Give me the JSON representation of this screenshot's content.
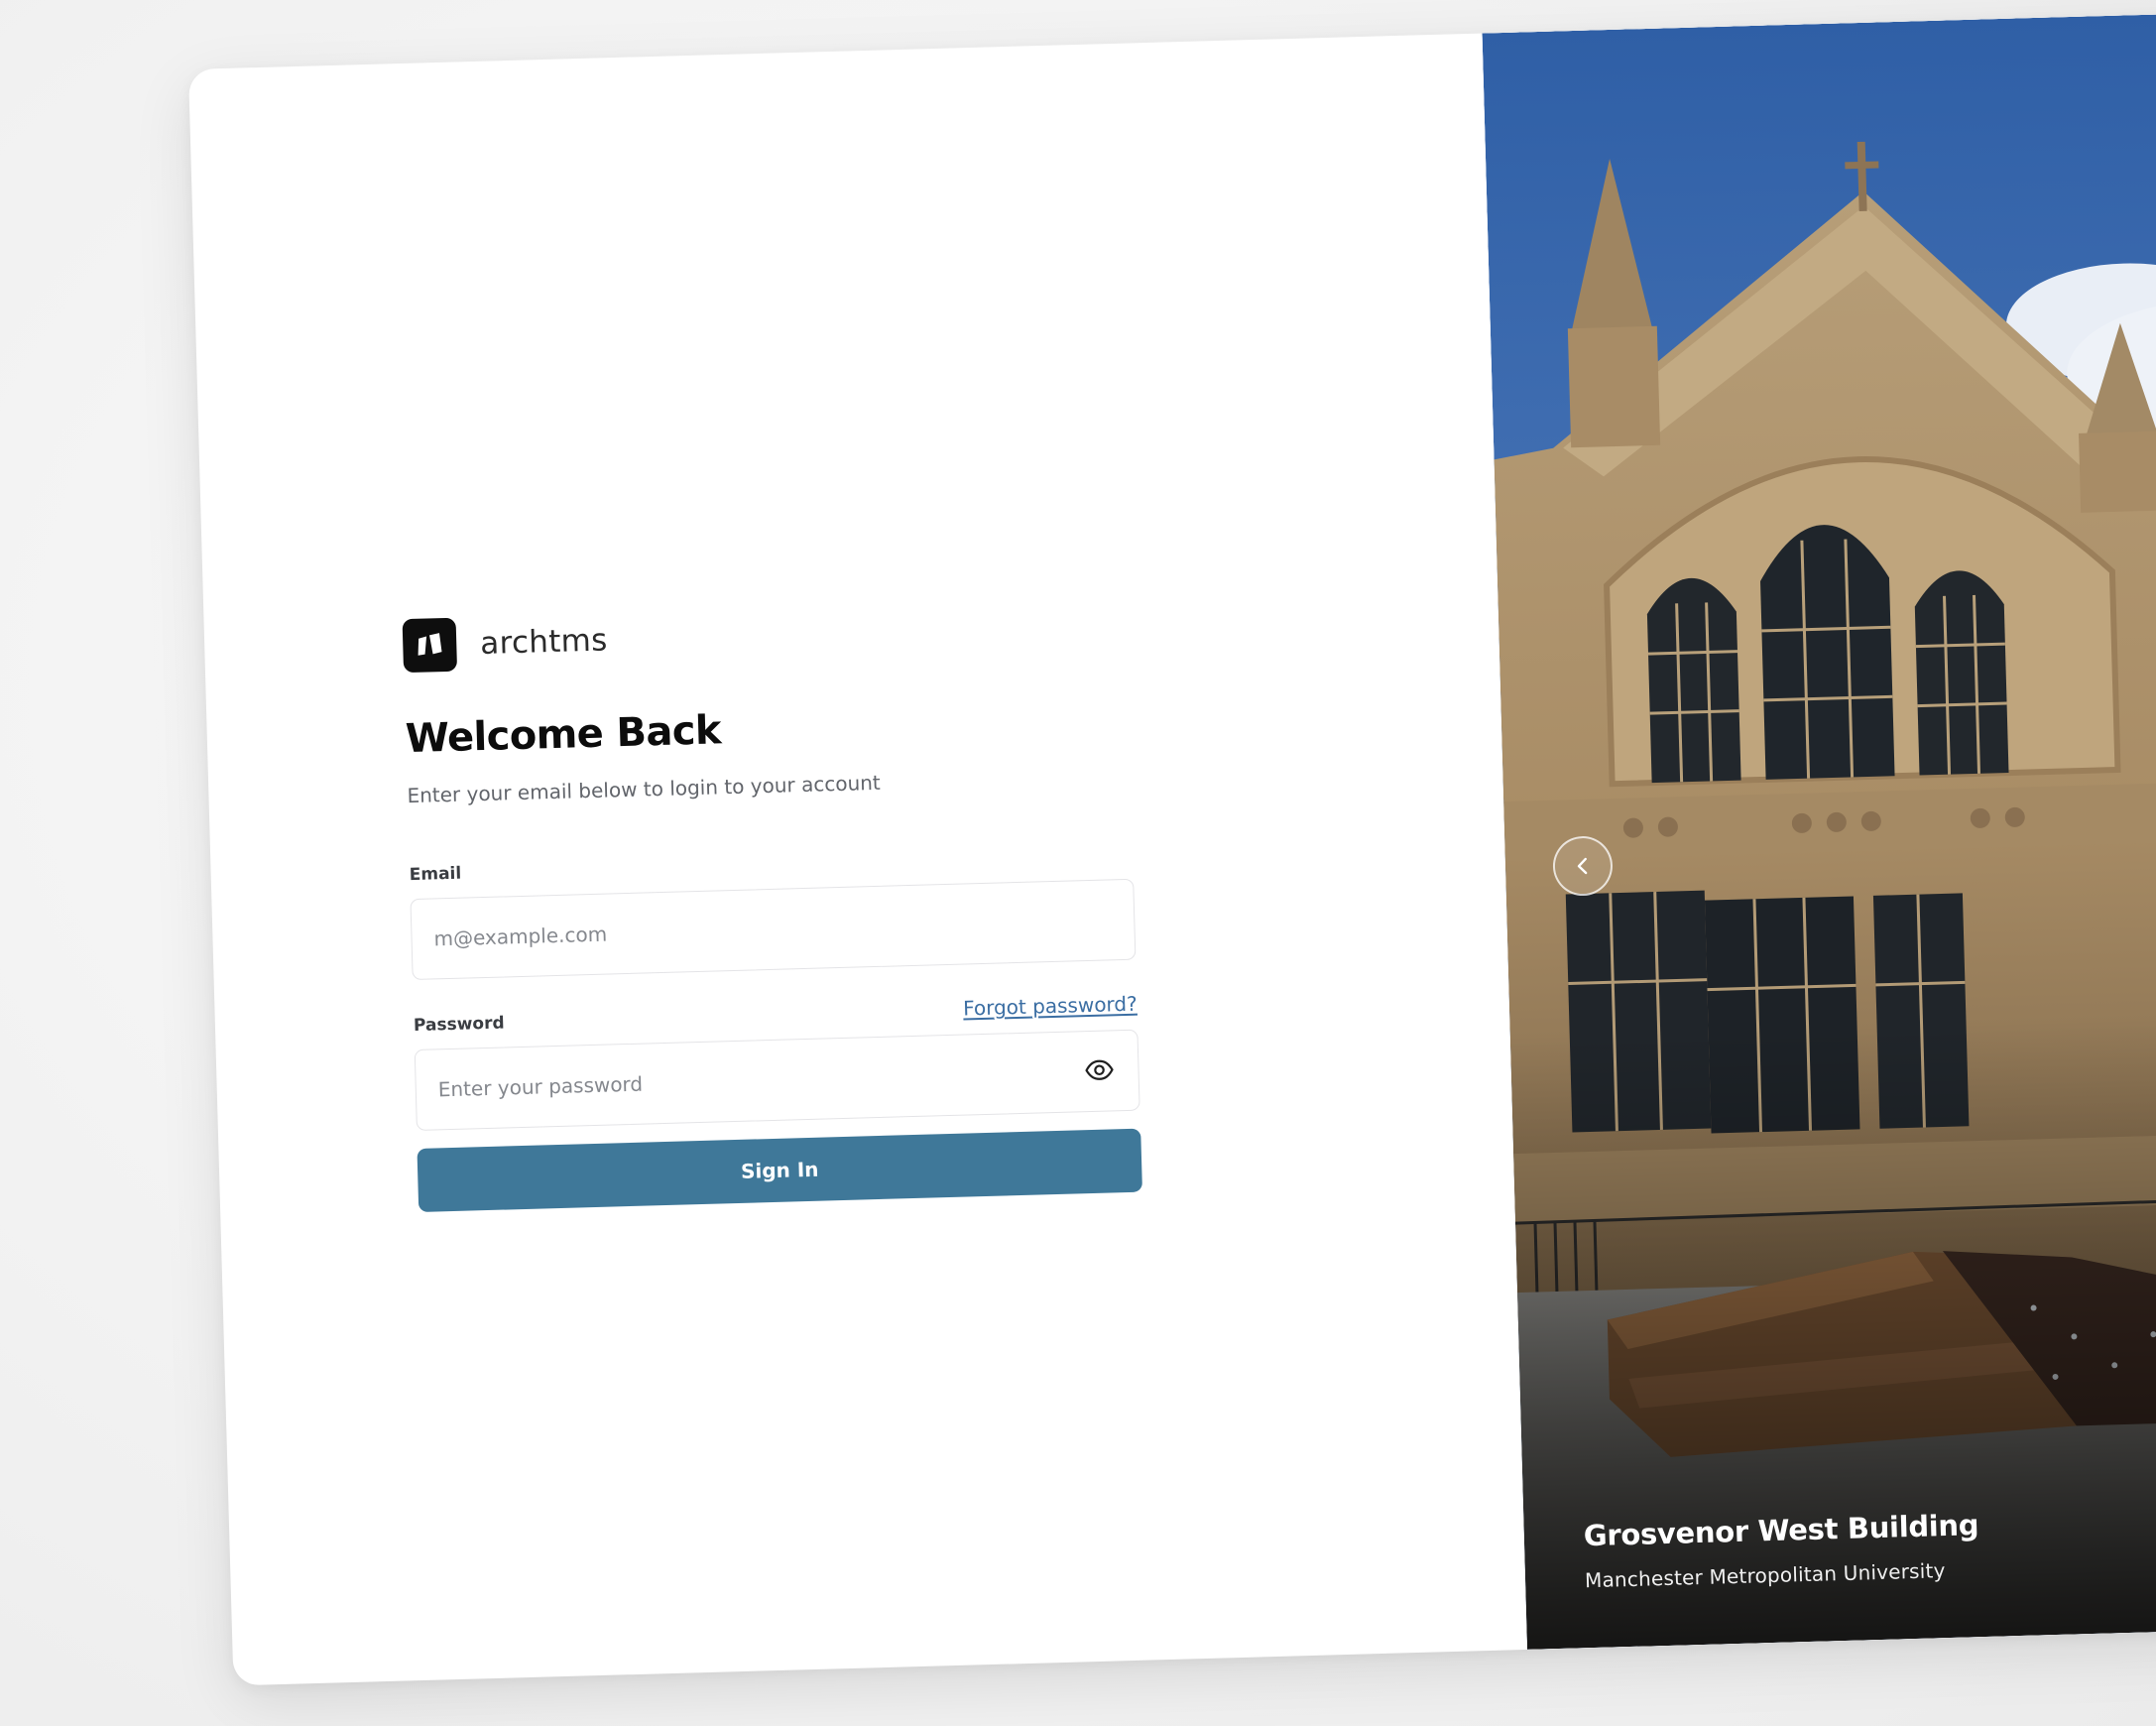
{
  "brand": {
    "name": "archtms"
  },
  "login": {
    "title": "Welcome Back",
    "subtitle": "Enter your email below to login to your account",
    "email_label": "Email",
    "email_placeholder": "m@example.com",
    "email_value": "",
    "password_label": "Password",
    "password_placeholder": "Enter your password",
    "password_value": "",
    "forgot_link": "Forgot password?",
    "submit_label": "Sign In"
  },
  "slide": {
    "title": "Grosvenor West Building",
    "subtitle": "Manchester Metropolitan University"
  },
  "icons": {
    "brand_logo": "brand-logo-icon",
    "password_toggle": "eye-icon",
    "previous_slide": "chevron-left-icon"
  },
  "colors": {
    "primary_button": "#3f7899",
    "link": "#3b6ea3",
    "title_text": "#0c0c0c",
    "muted_text": "#62656b",
    "logo_bg": "#0e0e0e"
  }
}
